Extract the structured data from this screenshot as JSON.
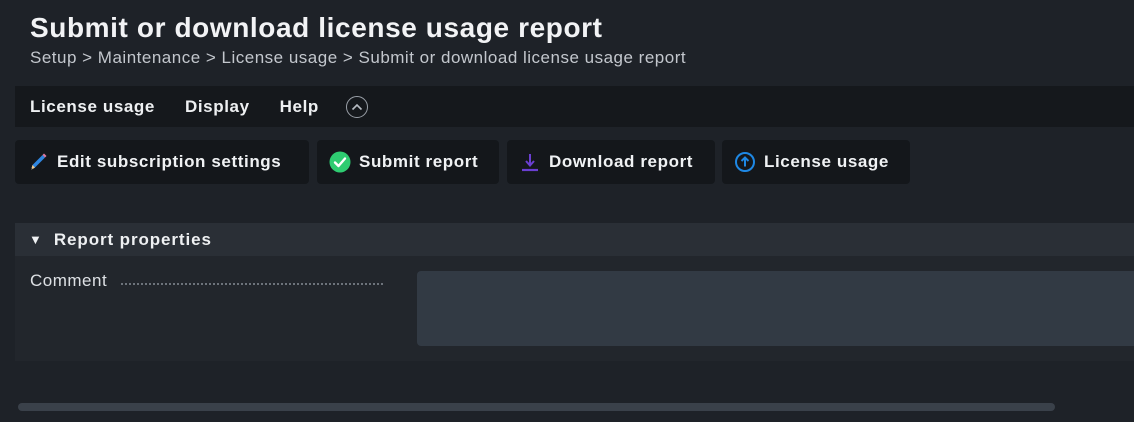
{
  "header": {
    "title": "Submit or download license usage report",
    "breadcrumb": "Setup > Maintenance > License usage > Submit or download license usage report"
  },
  "menubar": {
    "items": [
      {
        "label": "License usage"
      },
      {
        "label": "Display"
      },
      {
        "label": "Help"
      }
    ],
    "toggle_icon": "chevron-up-circle-icon"
  },
  "toolbar": {
    "buttons": [
      {
        "label": "Edit subscription settings",
        "icon": "pencil-icon"
      },
      {
        "label": "Submit report",
        "icon": "check-circle-icon"
      },
      {
        "label": "Download report",
        "icon": "download-icon"
      },
      {
        "label": "License usage",
        "icon": "upload-circle-icon"
      }
    ]
  },
  "form": {
    "section_title": "Report properties",
    "fields": [
      {
        "label": "Comment",
        "value": "",
        "placeholder": ""
      }
    ]
  },
  "colors": {
    "background": "#1e2228",
    "menubar": "#15181c",
    "accent_green": "#2ecc71",
    "accent_blue": "#1e88e5",
    "accent_purple": "#6a3fd1"
  }
}
